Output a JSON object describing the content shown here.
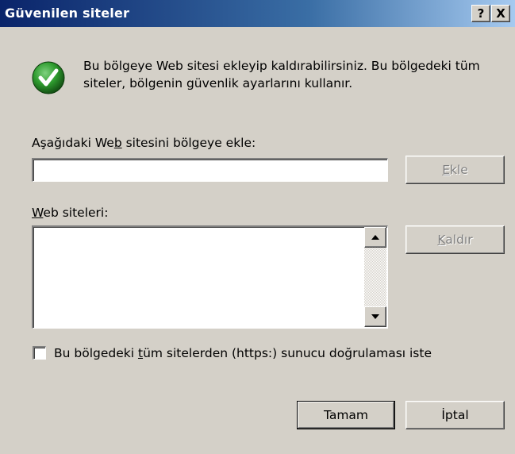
{
  "window": {
    "title": "Güvenilen siteler",
    "help_button": "?",
    "close_button": "X"
  },
  "info": {
    "icon": "check-icon",
    "text": "Bu bölgeye Web sitesi ekleyip kaldırabilirsiniz. Bu bölgedeki tüm siteler, bölgenin güvenlik ayarlarını kullanır."
  },
  "add_section": {
    "label_pre": "Aşağıdaki We",
    "label_accel": "b",
    "label_post": " sitesini bölgeye ekle:",
    "input_value": "",
    "add_button_accel": "E",
    "add_button_rest": "kle"
  },
  "sites_section": {
    "label_accel": "W",
    "label_rest": "eb siteleri:",
    "sites": [],
    "remove_button_accel": "K",
    "remove_button_rest": "aldır"
  },
  "https_option": {
    "checked": false,
    "label_pre": "Bu bölgedeki ",
    "label_accel": "t",
    "label_post": "üm sitelerden (https:) sunucu doğrulaması iste"
  },
  "footer": {
    "ok_label": "Tamam",
    "cancel_label": "İptal"
  },
  "colors": {
    "titlebar_start": "#0a246a",
    "titlebar_end": "#a6caf0",
    "dialog_bg": "#d4d0c8",
    "check_green": "#2e8b2e"
  }
}
